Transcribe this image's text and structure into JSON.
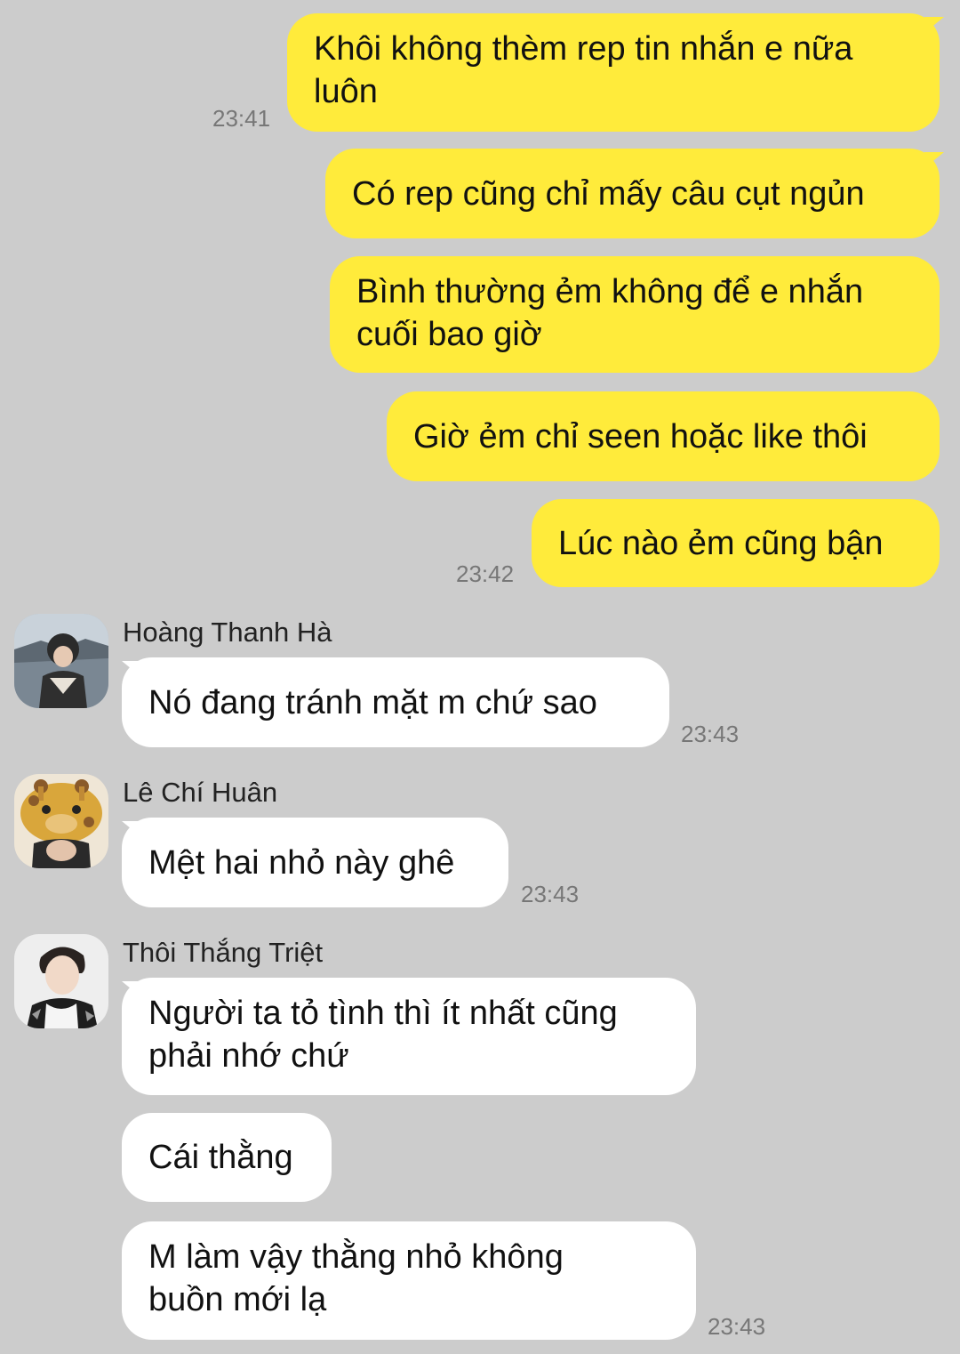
{
  "outgoing": [
    {
      "text_lines": [
        "Khôi không thèm rep tin nhắn e nữa",
        "luôn"
      ],
      "time": "23:41"
    },
    {
      "text_lines": [
        "Có rep cũng chỉ mấy câu cụt ngủn"
      ],
      "time": ""
    },
    {
      "text_lines": [
        "Bình thường ẻm không để e nhắn",
        "cuối bao giờ"
      ],
      "time": ""
    },
    {
      "text_lines": [
        "Giờ ẻm chỉ seen hoặc like thôi"
      ],
      "time": ""
    },
    {
      "text_lines": [
        "Lúc nào ẻm cũng bận"
      ],
      "time": "23:42"
    }
  ],
  "groups": [
    {
      "sender": "Hoàng Thanh Hà",
      "avatar": "avatar-photo-coast",
      "messages": [
        {
          "text_lines": [
            "Nó đang tránh mặt m chứ sao"
          ],
          "time": "23:43"
        }
      ]
    },
    {
      "sender": "Lê Chí Huân",
      "avatar": "avatar-photo-giraffe-hat",
      "messages": [
        {
          "text_lines": [
            "Mệt hai nhỏ này ghê"
          ],
          "time": "23:43"
        }
      ]
    },
    {
      "sender": "Thôi Thắng Triệt",
      "avatar": "avatar-photo-portrait",
      "messages": [
        {
          "text_lines": [
            "Người ta tỏ tình thì ít nhất cũng",
            "phải nhớ chứ"
          ],
          "time": ""
        },
        {
          "text_lines": [
            "Cái thằng"
          ],
          "time": ""
        },
        {
          "text_lines": [
            "M làm vậy thằng nhỏ không",
            "buồn mới lạ"
          ],
          "time": "23:43"
        }
      ]
    }
  ],
  "colors": {
    "background": "#cccccc",
    "outgoing_bubble": "#ffeb3b",
    "incoming_bubble": "#ffffff",
    "timestamp": "#777777"
  }
}
